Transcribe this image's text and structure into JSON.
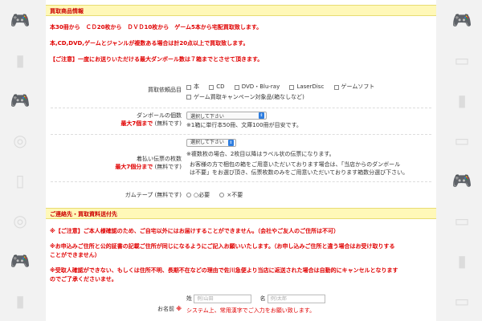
{
  "deco": {
    "icons_left": [
      "▶",
      "📁",
      "▮",
      "▶",
      "▬",
      "❍",
      "◆",
      "▮",
      "◎",
      "▣",
      "❏",
      "▮"
    ],
    "icons_right": [
      "◆",
      "▭",
      "▮",
      "▭",
      "◫",
      "❍",
      "▶",
      "▭",
      "▮",
      "▭",
      "◫",
      "▮"
    ]
  },
  "items_section": {
    "header": "買取商品情報",
    "notice1": "本30冊から　ＣＤ20枚から　ＤＶＤ10枚から　ゲーム5本から宅配買取致します。",
    "notice2": "本,CD,DVD,ゲームとジャンルが複数ある場合は計20点以上で買取致します。",
    "notice3": "【ご注意】一度にお送りいただける最大ダンボール数は７箱までとさせて頂きます。"
  },
  "item_types": {
    "label": "買取依頼品目",
    "options": [
      "本",
      "CD",
      "DVD・Blu-ray",
      "LaserDisc",
      "ゲームソフト"
    ],
    "campaign_option": "ゲーム買取キャンペーン対象品(箱なしなど)"
  },
  "box_count": {
    "label": "ダンボールの個数",
    "limit": "最大7個まで",
    "free": "(無料です)",
    "select_value": "選択して下さい",
    "note": "※1箱に単行本50冊、文庫100冊が目安です。"
  },
  "slip_count": {
    "select_value": "選択して下さい",
    "label": "着払い伝票の枚数",
    "limit": "最大7個分まで",
    "free": "(無料です)",
    "note1": "※複数枚の場合、2枚目以降はラベル状の伝票になります。",
    "note2": "お客様の方で梱包の箱をご用意いただいております場合は、「当店からのダンボール",
    "note3": "は不要」をお選び頂き、伝票枚数のみをご用意いただいております箱数分選び下さい。"
  },
  "gum_tape": {
    "label": "ガムテープ",
    "free": "(無料です)",
    "opt_need": "○必要",
    "opt_no": "×不要"
  },
  "contact_section": {
    "header": "ご連絡先・買取資料送付先",
    "notice1": "※【ご注意】ご本人様確認のため、ご自宅以外にはお届けすることができません。（会社やご友人のご住所は不可）",
    "notice2a": "※お申込みご住所と公的証書の記載ご住所が同じになるようにご記入お願いいたします。（お申し込みご住所と違う場合はお受け取りする",
    "notice2b": "ことができません）",
    "notice3a": "※受取人確認ができない、もしくは住所不明、長期不在などの理由で佐川急便より当店に返送された場合は自動的にキャンセルとなります",
    "notice3b": "のでご了承くださいませ。"
  },
  "name_field": {
    "label": "お名前",
    "required_mark": "※",
    "sei_label": "姓",
    "sei_placeholder": "例)山田",
    "mei_label": "名",
    "mei_placeholder": "例)太郎",
    "note": "システム上、常用漢字でご入力をお願い致します。"
  }
}
